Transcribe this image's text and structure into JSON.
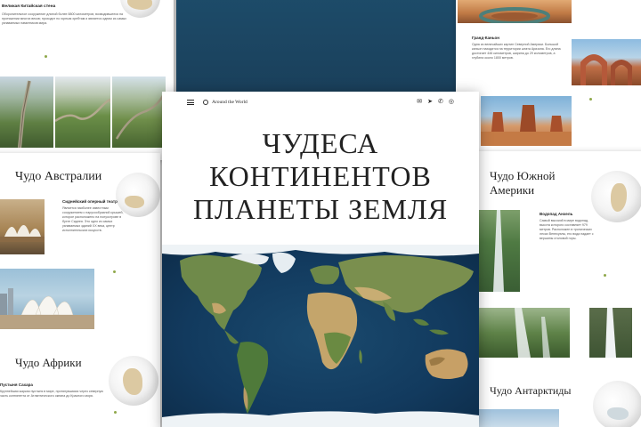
{
  "header": {
    "brand": "Around the World",
    "menu_icon": "hamburger-icon",
    "logo_icon": "compass-icon",
    "social": [
      {
        "name": "email-icon",
        "glyph": "✉"
      },
      {
        "name": "telegram-icon",
        "glyph": "➤"
      },
      {
        "name": "whatsapp-icon",
        "glyph": "✆"
      },
      {
        "name": "instagram-icon",
        "glyph": "◎"
      }
    ]
  },
  "hero": {
    "title_line1": "ЧУДЕСА",
    "title_line2": "КОНТИНЕНТОВ",
    "title_line3": "ПЛАНЕТЫ ЗЕМЛЯ"
  },
  "sections": {
    "china": {
      "title": "Великая Китайская стена",
      "text": "Оборонительное сооружение длиной более 8800 километров, возводившееся на протяжении многих веков; проходит по горным хребтам и является одним из самых узнаваемых памятников мира."
    },
    "australia": {
      "heading": "Чудо Австралии",
      "sub": "Сиднейский оперный театр",
      "text": "Является наиболее известным сооружением с парусообразной крышей, которое расположено на полуострове в бухте Сиднея. Это одно из самых узнаваемых зданий XX века, центр исполнительских искусств."
    },
    "africa": {
      "heading": "Чудо Африки",
      "sub": "Пустыня Сахара",
      "text": "Крупнейшая жаркая пустыня в мире, протянувшаяся через северную часть континента от Атлантического океана до Красного моря."
    },
    "canyon": {
      "sub": "Гранд-Каньон",
      "text": "Одна из величайших картин Северной Америки. Большой каньон находится на территории штата Аризона. Его длина достигает 446 километров, ширина до 29 километров, а глубина около 1800 метров."
    },
    "south_america": {
      "heading_line1": "Чудо Южной",
      "heading_line2": "Америки",
      "sub": "Водопад Анхель",
      "text": "Самый высокий в мире водопад, высота которого составляет 979 метров. Расположен в тропических лесах Венесуэлы, его вода падает с вершины столовой горы."
    },
    "antarctica": {
      "heading": "Чудо Антарктиды"
    }
  },
  "colors": {
    "ocean": "#123a5e",
    "land": "#6f8a4a",
    "desert": "#c4a56b",
    "ice": "#eef3f6",
    "accent": "#8fa84a"
  }
}
